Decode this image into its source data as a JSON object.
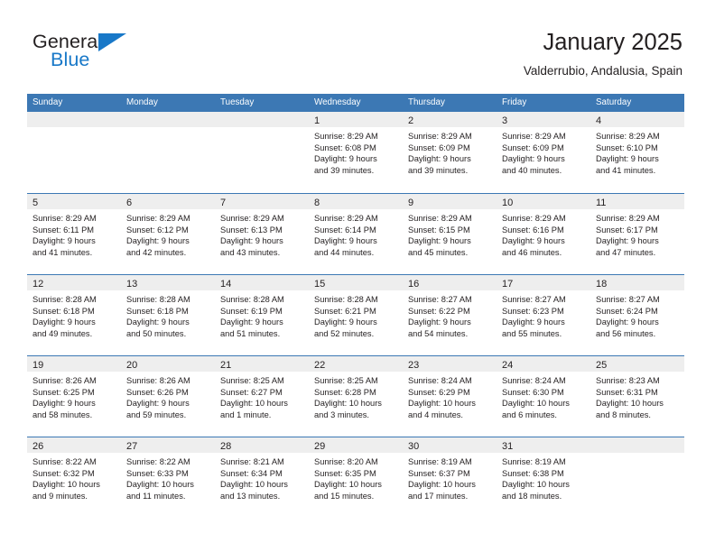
{
  "brand": {
    "name_top": "General",
    "name_bottom": "Blue",
    "triangle_icon": "triangle-icon",
    "accent_color": "#1878c8"
  },
  "header": {
    "title": "January 2025",
    "subtitle": "Valderrubio, Andalusia, Spain"
  },
  "calendar": {
    "header_color": "#3c78b4",
    "daynum_band_color": "#eeeeee",
    "weekdays": [
      "Sunday",
      "Monday",
      "Tuesday",
      "Wednesday",
      "Thursday",
      "Friday",
      "Saturday"
    ],
    "weeks": [
      [
        {
          "day": "",
          "empty": true
        },
        {
          "day": "",
          "empty": true
        },
        {
          "day": "",
          "empty": true
        },
        {
          "day": "1",
          "sunrise": "Sunrise: 8:29 AM",
          "sunset": "Sunset: 6:08 PM",
          "daylight_line1": "Daylight: 9 hours",
          "daylight_line2": "and 39 minutes."
        },
        {
          "day": "2",
          "sunrise": "Sunrise: 8:29 AM",
          "sunset": "Sunset: 6:09 PM",
          "daylight_line1": "Daylight: 9 hours",
          "daylight_line2": "and 39 minutes."
        },
        {
          "day": "3",
          "sunrise": "Sunrise: 8:29 AM",
          "sunset": "Sunset: 6:09 PM",
          "daylight_line1": "Daylight: 9 hours",
          "daylight_line2": "and 40 minutes."
        },
        {
          "day": "4",
          "sunrise": "Sunrise: 8:29 AM",
          "sunset": "Sunset: 6:10 PM",
          "daylight_line1": "Daylight: 9 hours",
          "daylight_line2": "and 41 minutes."
        }
      ],
      [
        {
          "day": "5",
          "sunrise": "Sunrise: 8:29 AM",
          "sunset": "Sunset: 6:11 PM",
          "daylight_line1": "Daylight: 9 hours",
          "daylight_line2": "and 41 minutes."
        },
        {
          "day": "6",
          "sunrise": "Sunrise: 8:29 AM",
          "sunset": "Sunset: 6:12 PM",
          "daylight_line1": "Daylight: 9 hours",
          "daylight_line2": "and 42 minutes."
        },
        {
          "day": "7",
          "sunrise": "Sunrise: 8:29 AM",
          "sunset": "Sunset: 6:13 PM",
          "daylight_line1": "Daylight: 9 hours",
          "daylight_line2": "and 43 minutes."
        },
        {
          "day": "8",
          "sunrise": "Sunrise: 8:29 AM",
          "sunset": "Sunset: 6:14 PM",
          "daylight_line1": "Daylight: 9 hours",
          "daylight_line2": "and 44 minutes."
        },
        {
          "day": "9",
          "sunrise": "Sunrise: 8:29 AM",
          "sunset": "Sunset: 6:15 PM",
          "daylight_line1": "Daylight: 9 hours",
          "daylight_line2": "and 45 minutes."
        },
        {
          "day": "10",
          "sunrise": "Sunrise: 8:29 AM",
          "sunset": "Sunset: 6:16 PM",
          "daylight_line1": "Daylight: 9 hours",
          "daylight_line2": "and 46 minutes."
        },
        {
          "day": "11",
          "sunrise": "Sunrise: 8:29 AM",
          "sunset": "Sunset: 6:17 PM",
          "daylight_line1": "Daylight: 9 hours",
          "daylight_line2": "and 47 minutes."
        }
      ],
      [
        {
          "day": "12",
          "sunrise": "Sunrise: 8:28 AM",
          "sunset": "Sunset: 6:18 PM",
          "daylight_line1": "Daylight: 9 hours",
          "daylight_line2": "and 49 minutes."
        },
        {
          "day": "13",
          "sunrise": "Sunrise: 8:28 AM",
          "sunset": "Sunset: 6:18 PM",
          "daylight_line1": "Daylight: 9 hours",
          "daylight_line2": "and 50 minutes."
        },
        {
          "day": "14",
          "sunrise": "Sunrise: 8:28 AM",
          "sunset": "Sunset: 6:19 PM",
          "daylight_line1": "Daylight: 9 hours",
          "daylight_line2": "and 51 minutes."
        },
        {
          "day": "15",
          "sunrise": "Sunrise: 8:28 AM",
          "sunset": "Sunset: 6:21 PM",
          "daylight_line1": "Daylight: 9 hours",
          "daylight_line2": "and 52 minutes."
        },
        {
          "day": "16",
          "sunrise": "Sunrise: 8:27 AM",
          "sunset": "Sunset: 6:22 PM",
          "daylight_line1": "Daylight: 9 hours",
          "daylight_line2": "and 54 minutes."
        },
        {
          "day": "17",
          "sunrise": "Sunrise: 8:27 AM",
          "sunset": "Sunset: 6:23 PM",
          "daylight_line1": "Daylight: 9 hours",
          "daylight_line2": "and 55 minutes."
        },
        {
          "day": "18",
          "sunrise": "Sunrise: 8:27 AM",
          "sunset": "Sunset: 6:24 PM",
          "daylight_line1": "Daylight: 9 hours",
          "daylight_line2": "and 56 minutes."
        }
      ],
      [
        {
          "day": "19",
          "sunrise": "Sunrise: 8:26 AM",
          "sunset": "Sunset: 6:25 PM",
          "daylight_line1": "Daylight: 9 hours",
          "daylight_line2": "and 58 minutes."
        },
        {
          "day": "20",
          "sunrise": "Sunrise: 8:26 AM",
          "sunset": "Sunset: 6:26 PM",
          "daylight_line1": "Daylight: 9 hours",
          "daylight_line2": "and 59 minutes."
        },
        {
          "day": "21",
          "sunrise": "Sunrise: 8:25 AM",
          "sunset": "Sunset: 6:27 PM",
          "daylight_line1": "Daylight: 10 hours",
          "daylight_line2": "and 1 minute."
        },
        {
          "day": "22",
          "sunrise": "Sunrise: 8:25 AM",
          "sunset": "Sunset: 6:28 PM",
          "daylight_line1": "Daylight: 10 hours",
          "daylight_line2": "and 3 minutes."
        },
        {
          "day": "23",
          "sunrise": "Sunrise: 8:24 AM",
          "sunset": "Sunset: 6:29 PM",
          "daylight_line1": "Daylight: 10 hours",
          "daylight_line2": "and 4 minutes."
        },
        {
          "day": "24",
          "sunrise": "Sunrise: 8:24 AM",
          "sunset": "Sunset: 6:30 PM",
          "daylight_line1": "Daylight: 10 hours",
          "daylight_line2": "and 6 minutes."
        },
        {
          "day": "25",
          "sunrise": "Sunrise: 8:23 AM",
          "sunset": "Sunset: 6:31 PM",
          "daylight_line1": "Daylight: 10 hours",
          "daylight_line2": "and 8 minutes."
        }
      ],
      [
        {
          "day": "26",
          "sunrise": "Sunrise: 8:22 AM",
          "sunset": "Sunset: 6:32 PM",
          "daylight_line1": "Daylight: 10 hours",
          "daylight_line2": "and 9 minutes."
        },
        {
          "day": "27",
          "sunrise": "Sunrise: 8:22 AM",
          "sunset": "Sunset: 6:33 PM",
          "daylight_line1": "Daylight: 10 hours",
          "daylight_line2": "and 11 minutes."
        },
        {
          "day": "28",
          "sunrise": "Sunrise: 8:21 AM",
          "sunset": "Sunset: 6:34 PM",
          "daylight_line1": "Daylight: 10 hours",
          "daylight_line2": "and 13 minutes."
        },
        {
          "day": "29",
          "sunrise": "Sunrise: 8:20 AM",
          "sunset": "Sunset: 6:35 PM",
          "daylight_line1": "Daylight: 10 hours",
          "daylight_line2": "and 15 minutes."
        },
        {
          "day": "30",
          "sunrise": "Sunrise: 8:19 AM",
          "sunset": "Sunset: 6:37 PM",
          "daylight_line1": "Daylight: 10 hours",
          "daylight_line2": "and 17 minutes."
        },
        {
          "day": "31",
          "sunrise": "Sunrise: 8:19 AM",
          "sunset": "Sunset: 6:38 PM",
          "daylight_line1": "Daylight: 10 hours",
          "daylight_line2": "and 18 minutes."
        },
        {
          "day": "",
          "empty": true
        }
      ]
    ]
  }
}
